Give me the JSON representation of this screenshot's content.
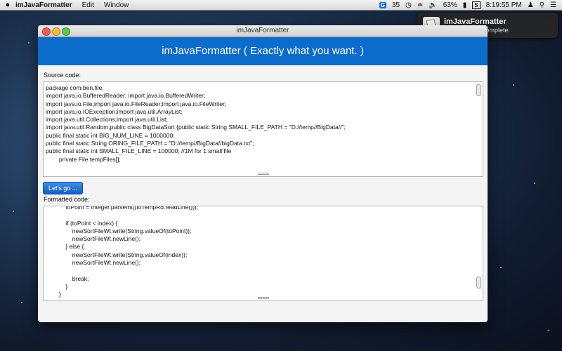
{
  "menubar": {
    "apple": "",
    "app_name": "imJavaFormatter",
    "menus": [
      "Edit",
      "Window"
    ],
    "status": {
      "tray_g_count": "35",
      "battery": "63%",
      "time": "8:19:55 PM"
    }
  },
  "notification": {
    "title": "imJavaFormatter",
    "body": "The format is complete."
  },
  "window": {
    "title": "imJavaFormatter",
    "banner": "imJavaFormatter ( Exactly what you want. )",
    "source_label": "Source code:",
    "source_code": "package com.ben.file;\nimport java.io.BufferedReader; import java.io.BufferedWriter;\nimport java.io.File;import java.io.FileReader;import java.io.FileWriter;\nimport java.io.IOException;import java.util.ArrayList;\nimport java.util.Collections;import java.util.List;\nimport java.util.Random;public class BigDataSort {public static String SMALL_FILE_PATH = \"D://temp//BigData//\";\npublic final static int BIG_NUM_LINE = 1000000;\npublic final static String ORING_FILE_PATH = \"D://temp//BigData//bigData.txt\";\npublic final static int SMALL_FILE_LINE = 100000; //1M for 1 small file\n        private File tempFiles[];",
    "button_label": "Let's go ...",
    "formatted_label": "Formatted code:",
    "formatted_code": "            toPoint = Integer.parseInt((toTempRd.readLine()));\n\n            if (toPoint < index) {\n                newSortFileWt.write(String.valueOf(toPoint));\n                newSortFileWt.newLine();\n            } else {\n                newSortFileWt.write(String.valueOf(index));\n                newSortFileWt.newLine();\n\n                break;\n            }\n        }"
  },
  "colors": {
    "banner": "#0b6ccc",
    "button": "#1d6fd6"
  }
}
